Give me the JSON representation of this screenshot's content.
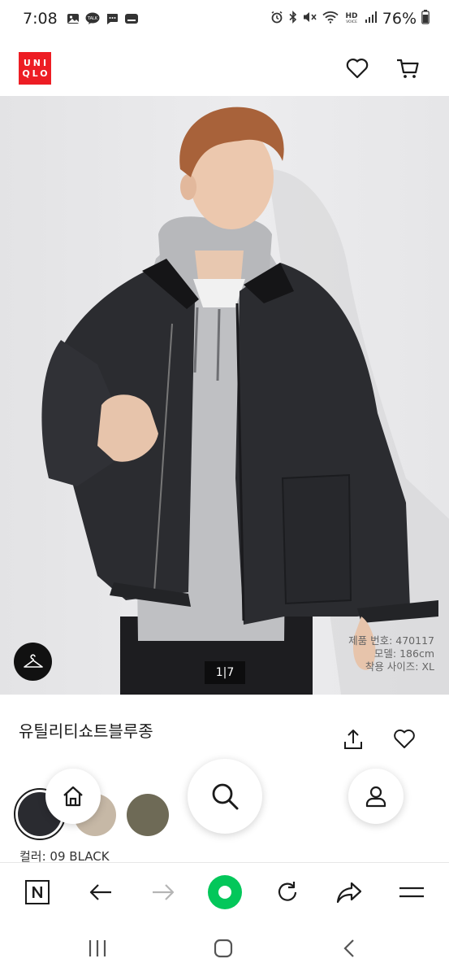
{
  "status_bar": {
    "time": "7:08",
    "battery": "76%",
    "icons": [
      "gallery-icon",
      "talk-icon",
      "chat-icon",
      "wallet-icon",
      "alarm-icon",
      "bluetooth-icon",
      "mute-icon",
      "wifi-icon",
      "hd-voice-icon",
      "signal-icon",
      "battery-icon"
    ]
  },
  "header": {
    "logo_line1": "UNI",
    "logo_line2": "QLO",
    "icons": [
      "heart-icon",
      "cart-icon"
    ]
  },
  "hero": {
    "pager": "1|7",
    "model_info": [
      "제품 번호: 470117",
      "모델: 186cm",
      "착용 사이즈: XL"
    ]
  },
  "product": {
    "name": "유틸리티쇼트블루종",
    "color_label": "컬러: 09 BLACK",
    "swatch_colors": [
      "#2a2b30",
      "#c6b8a6",
      "#6e6a56"
    ]
  },
  "colors": {
    "brand": "#ed1d24",
    "browser_accent": "#03c75a"
  },
  "browser": {
    "icons": [
      "naver-icon",
      "back-arrow-icon",
      "forward-arrow-icon",
      "green-dot-icon",
      "reload-icon",
      "share-icon",
      "menu-icon"
    ]
  }
}
